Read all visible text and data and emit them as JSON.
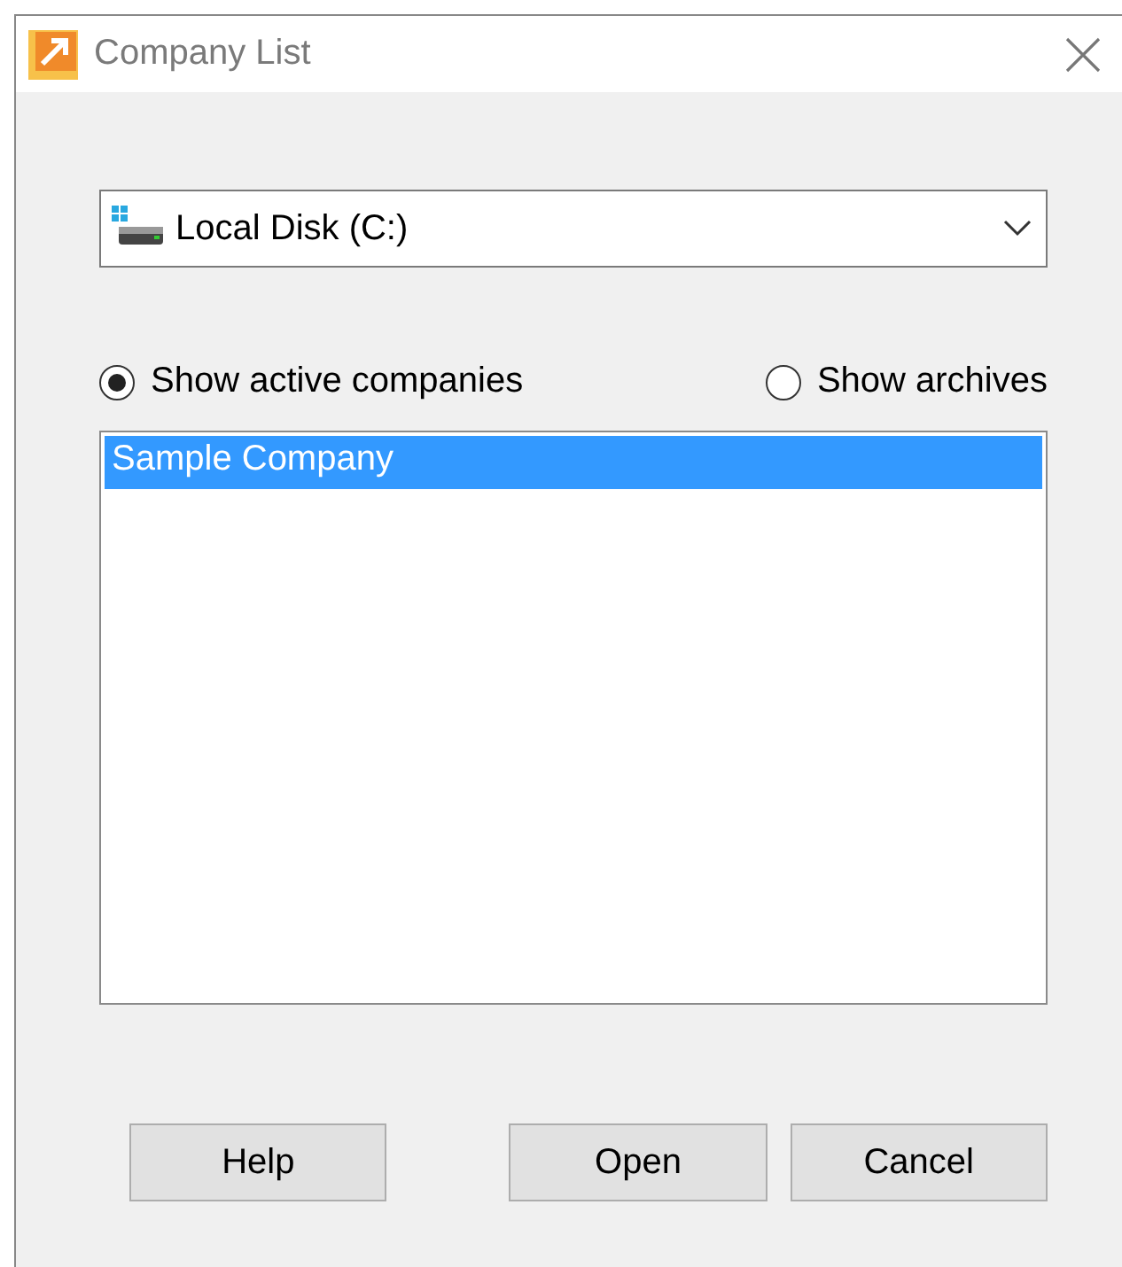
{
  "window": {
    "title": "Company List"
  },
  "drive_select": {
    "value": "Local Disk (C:)"
  },
  "filter": [
    {
      "label": "Show active companies",
      "selected": true
    },
    {
      "label": "Show archives",
      "selected": false
    }
  ],
  "companies": [
    {
      "name": "Sample Company",
      "selected": true
    }
  ],
  "buttons": [
    "Help",
    "Open",
    "Cancel"
  ]
}
